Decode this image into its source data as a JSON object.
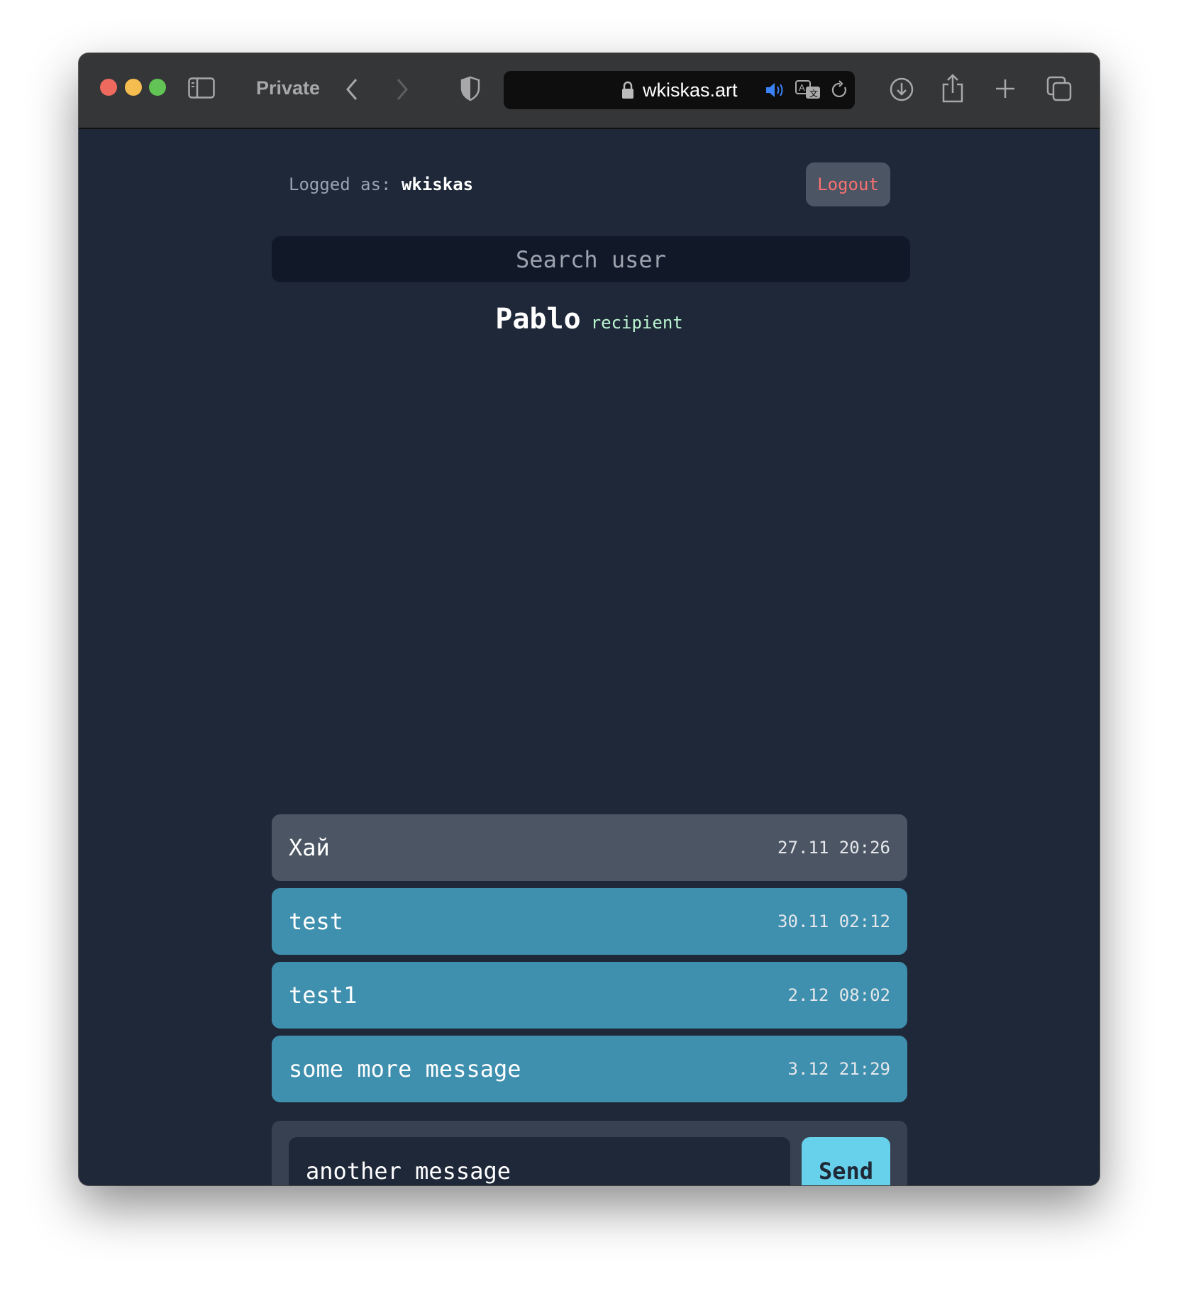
{
  "browser": {
    "private_label": "Private",
    "url": "wkiskas.art",
    "traffic_lights": {
      "close": "#ee6a5f",
      "minimize": "#f5bd4f",
      "maximize": "#61c454"
    }
  },
  "header": {
    "logged_as_label": "Logged as:",
    "username": "wkiskas",
    "logout_label": "Logout"
  },
  "search": {
    "placeholder": "Search user"
  },
  "recipient": {
    "name": "Pablo",
    "tag": "recipient"
  },
  "messages": [
    {
      "text": "Хай",
      "time": "27.11 20:26",
      "color": "#4b5563"
    },
    {
      "text": "test",
      "time": "30.11 02:12",
      "color": "#3f8fae"
    },
    {
      "text": "test1",
      "time": "2.12 08:02",
      "color": "#3f8fae"
    },
    {
      "text": "some more message",
      "time": "3.12 21:29",
      "color": "#3f8fae"
    }
  ],
  "composer": {
    "value": "another message",
    "send_label": "Send"
  }
}
